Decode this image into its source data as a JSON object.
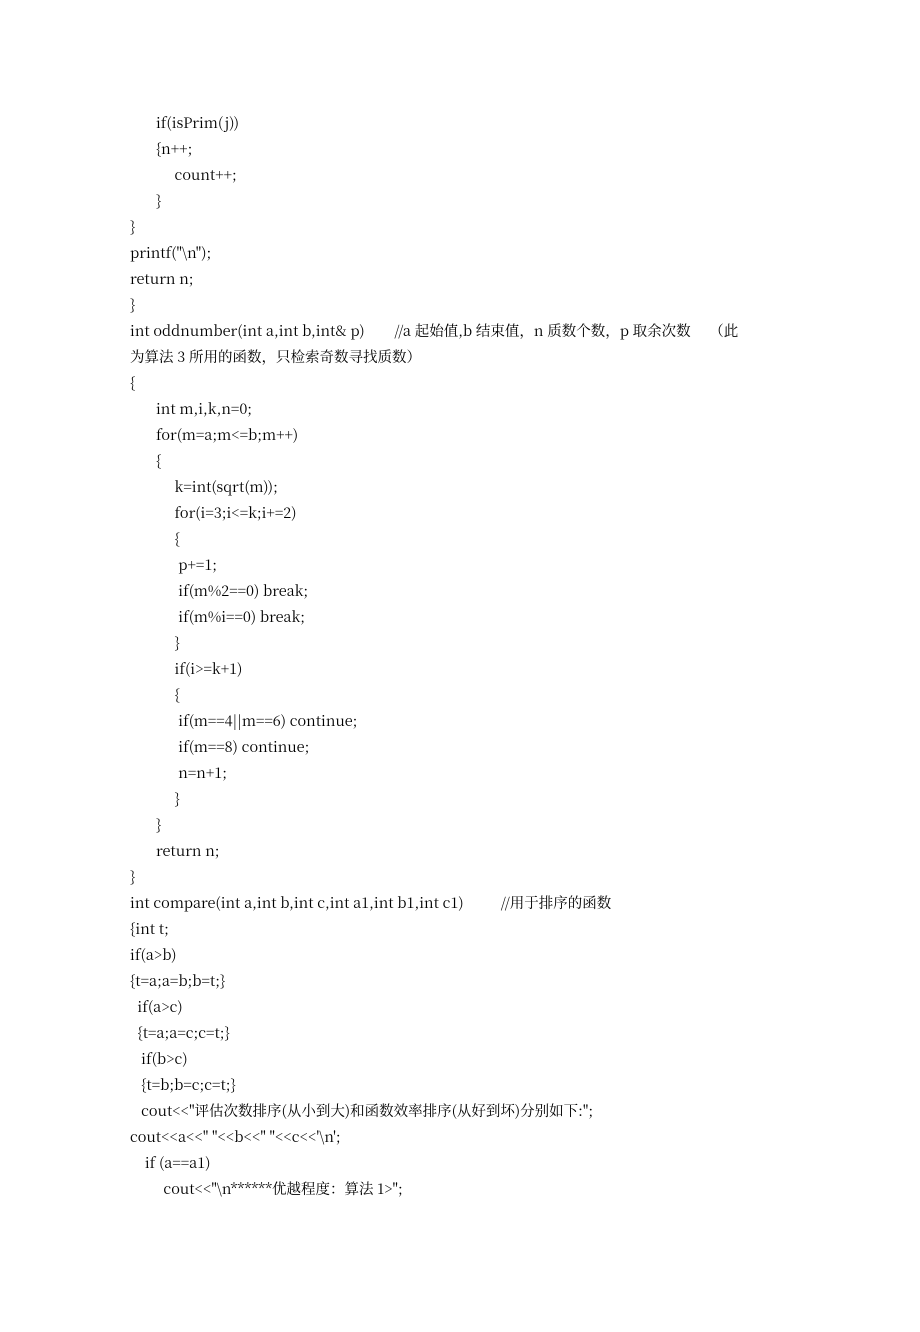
{
  "lines": [
    "       if(isPrim(j))",
    "       {n++;",
    "            count++;",
    "       }",
    "}",
    "printf(\"\\n\");",
    "return n;",
    "}",
    "int oddnumber(int a,int b,int& p)        //a 起始值,b 结束值，n 质数个数，p 取余次数     （此",
    "为算法 3 所用的函数，只检索奇数寻找质数）",
    "{",
    "       int m,i,k,n=0;",
    "       for(m=a;m<=b;m++)",
    "       {",
    "            k=int(sqrt(m));",
    "            for(i=3;i<=k;i+=2)",
    "            {",
    "             p+=1;",
    "             if(m%2==0) break;",
    "             if(m%i==0) break;",
    "            }",
    "            if(i>=k+1)",
    "            {",
    "             if(m==4||m==6) continue;",
    "             if(m==8) continue;",
    "             n=n+1;",
    "            }",
    "",
    "       }",
    "       return n;",
    "}",
    "int compare(int a,int b,int c,int a1,int b1,int c1)          //用于排序的函数",
    "{int t;",
    "if(a>b)",
    "{t=a;a=b;b=t;}",
    "  if(a>c)",
    "  {t=a;a=c;c=t;}",
    "   if(b>c)",
    "   {t=b;b=c;c=t;}",
    "   cout<<\"评估次数排序(从小到大)和函数效率排序(从好到坏)分别如下:\";",
    "cout<<a<<\" \"<<b<<\" \"<<c<<'\\n';",
    "",
    "    if (a==a1)",
    "         cout<<\"\\n******优越程度：算法 1>\";"
  ]
}
